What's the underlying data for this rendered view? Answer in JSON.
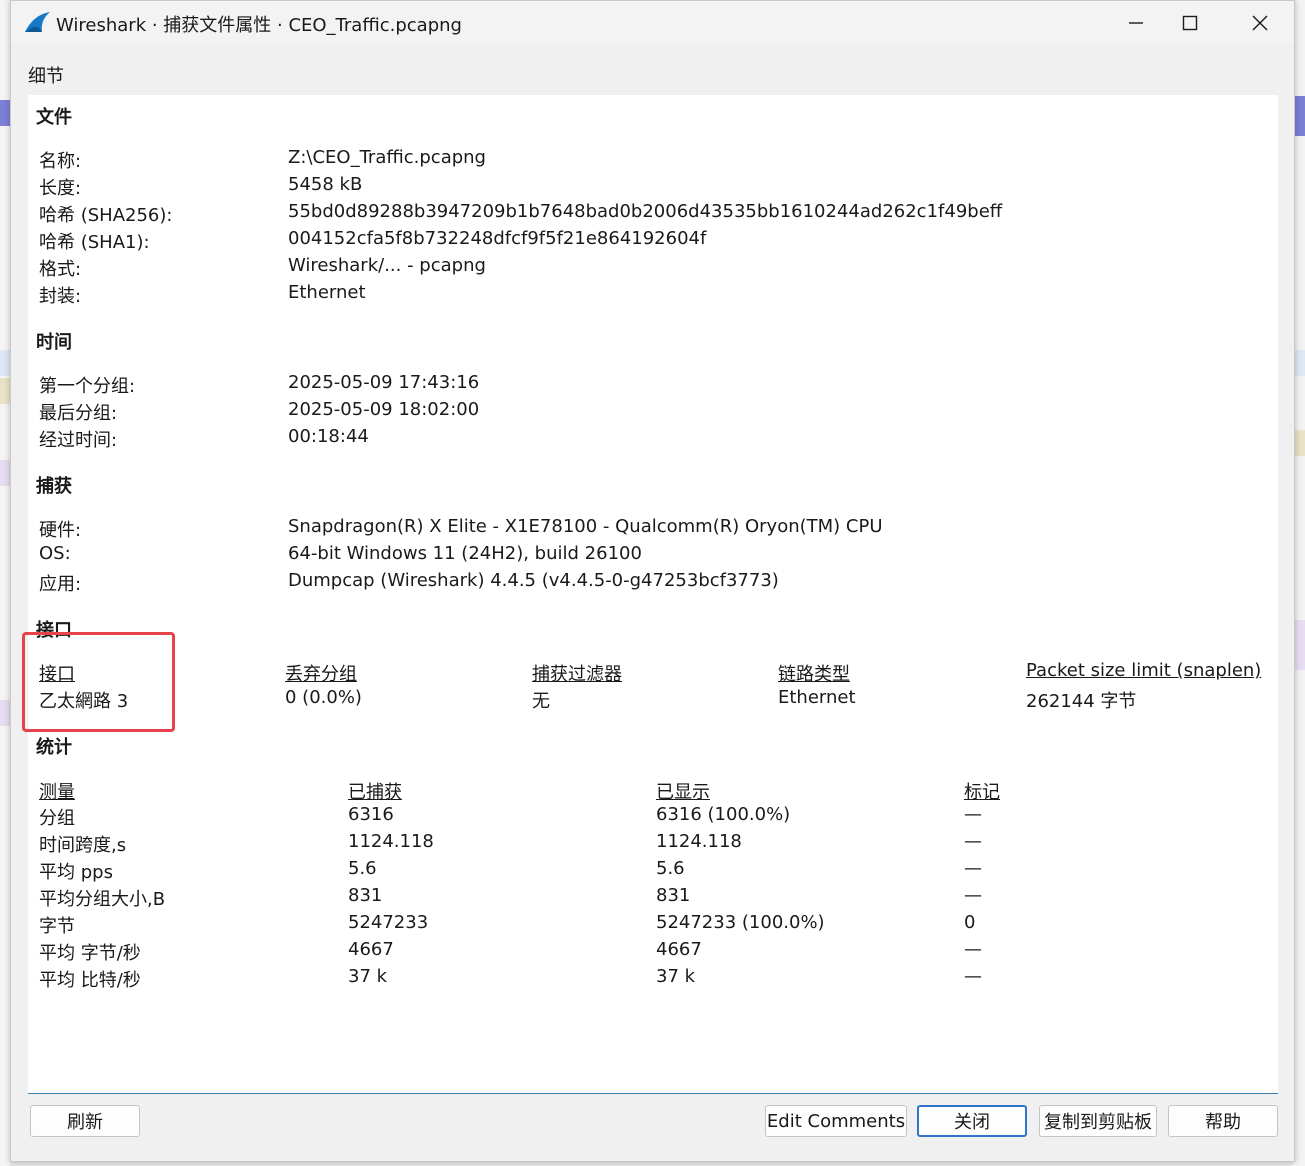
{
  "window": {
    "title": "Wireshark · 捕获文件属性 · CEO_Traffic.pcapng"
  },
  "details_caption": "细节",
  "file": {
    "heading": "文件",
    "rows": [
      {
        "label": "名称:",
        "value": "Z:\\CEO_Traffic.pcapng"
      },
      {
        "label": "长度:",
        "value": "5458 kB"
      },
      {
        "label": "哈希 (SHA256):",
        "value": "55bd0d89288b3947209b1b7648bad0b2006d43535bb1610244ad262c1f49beff"
      },
      {
        "label": "哈希 (SHA1):",
        "value": "004152cfa5f8b732248dfcf9f5f21e864192604f"
      },
      {
        "label": "格式:",
        "value": "Wireshark/... - pcapng"
      },
      {
        "label": "封装:",
        "value": "Ethernet"
      }
    ]
  },
  "time": {
    "heading": "时间",
    "rows": [
      {
        "label": "第一个分组:",
        "value": "2025-05-09 17:43:16"
      },
      {
        "label": "最后分组:",
        "value": "2025-05-09 18:02:00"
      },
      {
        "label": "经过时间:",
        "value": "00:18:44"
      }
    ]
  },
  "capture": {
    "heading": "捕获",
    "rows": [
      {
        "label": "硬件:",
        "value": "Snapdragon(R) X Elite - X1E78100 - Qualcomm(R) Oryon(TM) CPU"
      },
      {
        "label": "OS:",
        "value": "64-bit Windows 11 (24H2), build 26100"
      },
      {
        "label": "应用:",
        "value": "Dumpcap (Wireshark) 4.4.5 (v4.4.5-0-g47253bcf3773)"
      }
    ]
  },
  "interfaces": {
    "heading": "接口",
    "columns": [
      "接口",
      "丢弃分组",
      "捕获过滤器",
      "链路类型",
      "Packet size limit (snaplen)"
    ],
    "row": [
      "乙太網路 3",
      "0 (0.0%)",
      "无",
      "Ethernet",
      "262144 字节"
    ]
  },
  "statistics": {
    "heading": "统计",
    "columns": [
      "测量",
      "已捕获",
      "已显示",
      "标记"
    ],
    "rows": [
      [
        "分组",
        "6316",
        "6316 (100.0%)",
        "—"
      ],
      [
        "时间跨度,s",
        "1124.118",
        "1124.118",
        "—"
      ],
      [
        "平均 pps",
        "5.6",
        "5.6",
        "—"
      ],
      [
        "平均分组大小,B",
        "831",
        "831",
        "—"
      ],
      [
        "字节",
        "5247233",
        "5247233 (100.0%)",
        "0"
      ],
      [
        "平均 字节/秒",
        "4667",
        "4667",
        "—"
      ],
      [
        "平均 比特/秒",
        "37 k",
        "37 k",
        "—"
      ]
    ]
  },
  "buttons": {
    "refresh": "刷新",
    "edit_comments": "Edit Comments",
    "close": "关闭",
    "copy": "复制到剪贴板",
    "help": "帮助"
  },
  "icons": {
    "app": "wireshark-fin-icon",
    "minimize": "minimize-icon",
    "maximize": "maximize-icon",
    "close": "close-icon"
  },
  "colors": {
    "highlight": "#e8434a",
    "accent": "#2e74c9"
  }
}
